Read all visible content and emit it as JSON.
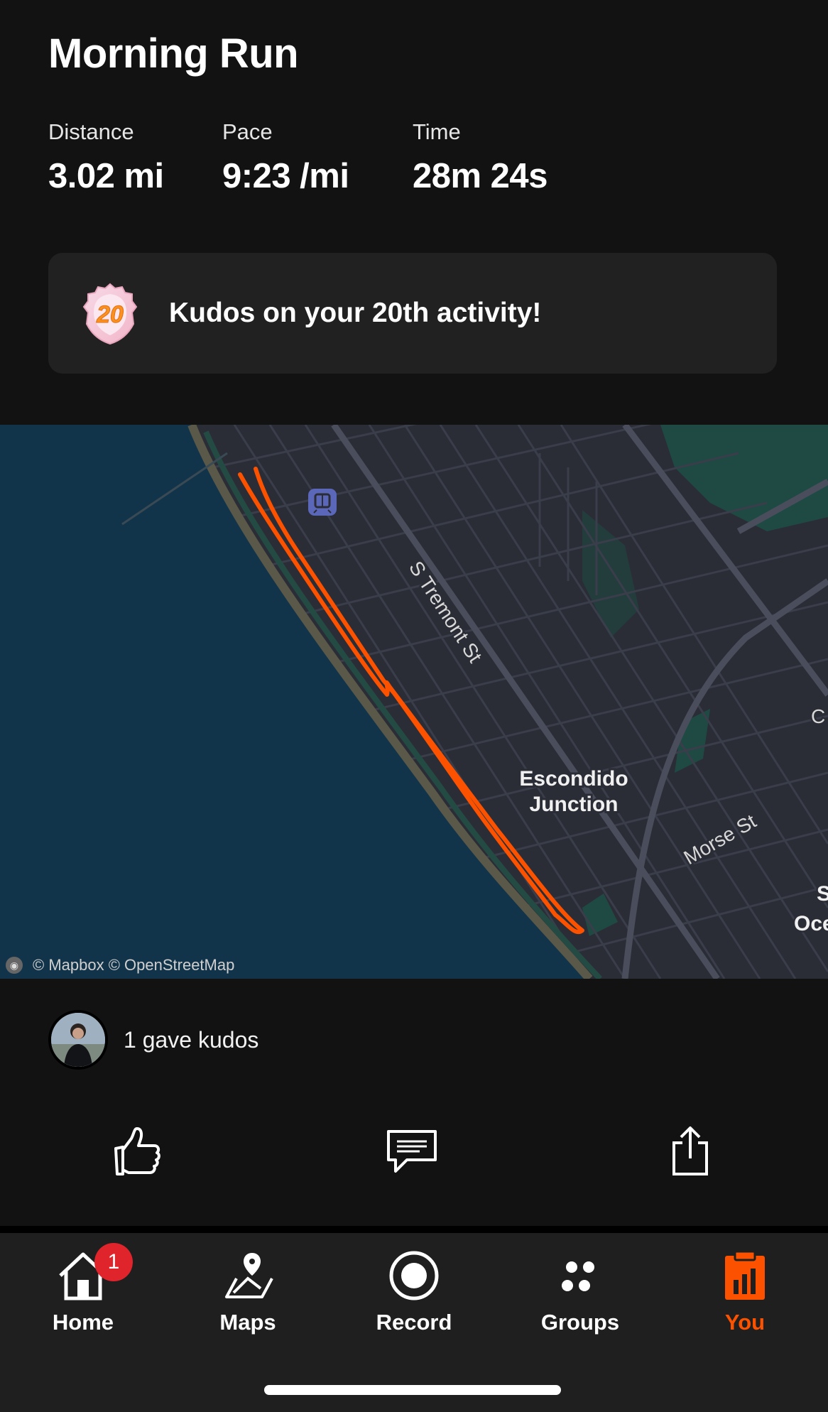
{
  "activity": {
    "title": "Morning Run",
    "stats": [
      {
        "label": "Distance",
        "value": "3.02 mi"
      },
      {
        "label": "Pace",
        "value": "9:23 /mi"
      },
      {
        "label": "Time",
        "value": "28m 24s"
      }
    ]
  },
  "achievement": {
    "badge_number": "20",
    "message": "Kudos on your 20th activity!"
  },
  "map": {
    "labels": {
      "street_tremont": "S Tremont St",
      "place_escondido_line1": "Escondido",
      "place_escondido_line2": "Junction",
      "street_morse": "Morse St",
      "edge_c": "C",
      "edge_s": "S",
      "edge_oce": "Oce"
    },
    "attribution": "© Mapbox © OpenStreetMap",
    "route_color": "#fc5200",
    "water_color": "#12344a",
    "land_color": "#2b2d36"
  },
  "kudos": {
    "text": "1 gave kudos"
  },
  "actions": {
    "like_icon": "thumbs-up-icon",
    "comment_icon": "comment-icon",
    "share_icon": "share-icon"
  },
  "tabbar": {
    "items": [
      {
        "label": "Home",
        "icon": "home-icon",
        "badge": "1"
      },
      {
        "label": "Maps",
        "icon": "maps-icon"
      },
      {
        "label": "Record",
        "icon": "record-icon"
      },
      {
        "label": "Groups",
        "icon": "groups-icon"
      },
      {
        "label": "You",
        "icon": "you-icon",
        "active": true
      }
    ],
    "active_color": "#fc5200"
  }
}
